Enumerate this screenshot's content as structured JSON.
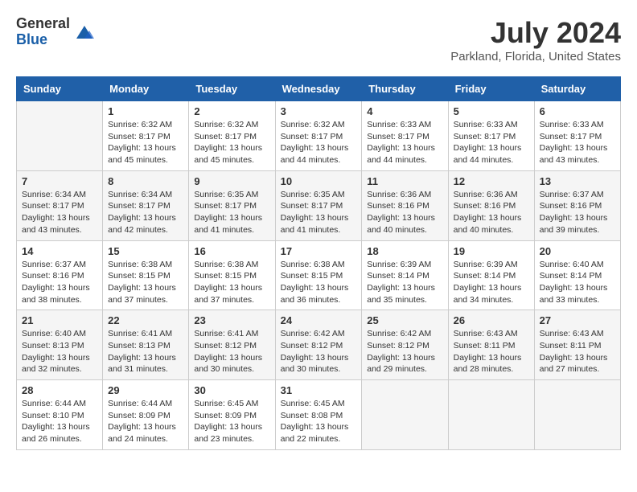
{
  "header": {
    "logo_general": "General",
    "logo_blue": "Blue",
    "month_year": "July 2024",
    "location": "Parkland, Florida, United States"
  },
  "days_of_week": [
    "Sunday",
    "Monday",
    "Tuesday",
    "Wednesday",
    "Thursday",
    "Friday",
    "Saturday"
  ],
  "weeks": [
    [
      {
        "day": "",
        "info": ""
      },
      {
        "day": "1",
        "info": "Sunrise: 6:32 AM\nSunset: 8:17 PM\nDaylight: 13 hours\nand 45 minutes."
      },
      {
        "day": "2",
        "info": "Sunrise: 6:32 AM\nSunset: 8:17 PM\nDaylight: 13 hours\nand 45 minutes."
      },
      {
        "day": "3",
        "info": "Sunrise: 6:32 AM\nSunset: 8:17 PM\nDaylight: 13 hours\nand 44 minutes."
      },
      {
        "day": "4",
        "info": "Sunrise: 6:33 AM\nSunset: 8:17 PM\nDaylight: 13 hours\nand 44 minutes."
      },
      {
        "day": "5",
        "info": "Sunrise: 6:33 AM\nSunset: 8:17 PM\nDaylight: 13 hours\nand 44 minutes."
      },
      {
        "day": "6",
        "info": "Sunrise: 6:33 AM\nSunset: 8:17 PM\nDaylight: 13 hours\nand 43 minutes."
      }
    ],
    [
      {
        "day": "7",
        "info": "Sunrise: 6:34 AM\nSunset: 8:17 PM\nDaylight: 13 hours\nand 43 minutes."
      },
      {
        "day": "8",
        "info": "Sunrise: 6:34 AM\nSunset: 8:17 PM\nDaylight: 13 hours\nand 42 minutes."
      },
      {
        "day": "9",
        "info": "Sunrise: 6:35 AM\nSunset: 8:17 PM\nDaylight: 13 hours\nand 41 minutes."
      },
      {
        "day": "10",
        "info": "Sunrise: 6:35 AM\nSunset: 8:17 PM\nDaylight: 13 hours\nand 41 minutes."
      },
      {
        "day": "11",
        "info": "Sunrise: 6:36 AM\nSunset: 8:16 PM\nDaylight: 13 hours\nand 40 minutes."
      },
      {
        "day": "12",
        "info": "Sunrise: 6:36 AM\nSunset: 8:16 PM\nDaylight: 13 hours\nand 40 minutes."
      },
      {
        "day": "13",
        "info": "Sunrise: 6:37 AM\nSunset: 8:16 PM\nDaylight: 13 hours\nand 39 minutes."
      }
    ],
    [
      {
        "day": "14",
        "info": "Sunrise: 6:37 AM\nSunset: 8:16 PM\nDaylight: 13 hours\nand 38 minutes."
      },
      {
        "day": "15",
        "info": "Sunrise: 6:38 AM\nSunset: 8:15 PM\nDaylight: 13 hours\nand 37 minutes."
      },
      {
        "day": "16",
        "info": "Sunrise: 6:38 AM\nSunset: 8:15 PM\nDaylight: 13 hours\nand 37 minutes."
      },
      {
        "day": "17",
        "info": "Sunrise: 6:38 AM\nSunset: 8:15 PM\nDaylight: 13 hours\nand 36 minutes."
      },
      {
        "day": "18",
        "info": "Sunrise: 6:39 AM\nSunset: 8:14 PM\nDaylight: 13 hours\nand 35 minutes."
      },
      {
        "day": "19",
        "info": "Sunrise: 6:39 AM\nSunset: 8:14 PM\nDaylight: 13 hours\nand 34 minutes."
      },
      {
        "day": "20",
        "info": "Sunrise: 6:40 AM\nSunset: 8:14 PM\nDaylight: 13 hours\nand 33 minutes."
      }
    ],
    [
      {
        "day": "21",
        "info": "Sunrise: 6:40 AM\nSunset: 8:13 PM\nDaylight: 13 hours\nand 32 minutes."
      },
      {
        "day": "22",
        "info": "Sunrise: 6:41 AM\nSunset: 8:13 PM\nDaylight: 13 hours\nand 31 minutes."
      },
      {
        "day": "23",
        "info": "Sunrise: 6:41 AM\nSunset: 8:12 PM\nDaylight: 13 hours\nand 30 minutes."
      },
      {
        "day": "24",
        "info": "Sunrise: 6:42 AM\nSunset: 8:12 PM\nDaylight: 13 hours\nand 30 minutes."
      },
      {
        "day": "25",
        "info": "Sunrise: 6:42 AM\nSunset: 8:12 PM\nDaylight: 13 hours\nand 29 minutes."
      },
      {
        "day": "26",
        "info": "Sunrise: 6:43 AM\nSunset: 8:11 PM\nDaylight: 13 hours\nand 28 minutes."
      },
      {
        "day": "27",
        "info": "Sunrise: 6:43 AM\nSunset: 8:11 PM\nDaylight: 13 hours\nand 27 minutes."
      }
    ],
    [
      {
        "day": "28",
        "info": "Sunrise: 6:44 AM\nSunset: 8:10 PM\nDaylight: 13 hours\nand 26 minutes."
      },
      {
        "day": "29",
        "info": "Sunrise: 6:44 AM\nSunset: 8:09 PM\nDaylight: 13 hours\nand 24 minutes."
      },
      {
        "day": "30",
        "info": "Sunrise: 6:45 AM\nSunset: 8:09 PM\nDaylight: 13 hours\nand 23 minutes."
      },
      {
        "day": "31",
        "info": "Sunrise: 6:45 AM\nSunset: 8:08 PM\nDaylight: 13 hours\nand 22 minutes."
      },
      {
        "day": "",
        "info": ""
      },
      {
        "day": "",
        "info": ""
      },
      {
        "day": "",
        "info": ""
      }
    ]
  ]
}
